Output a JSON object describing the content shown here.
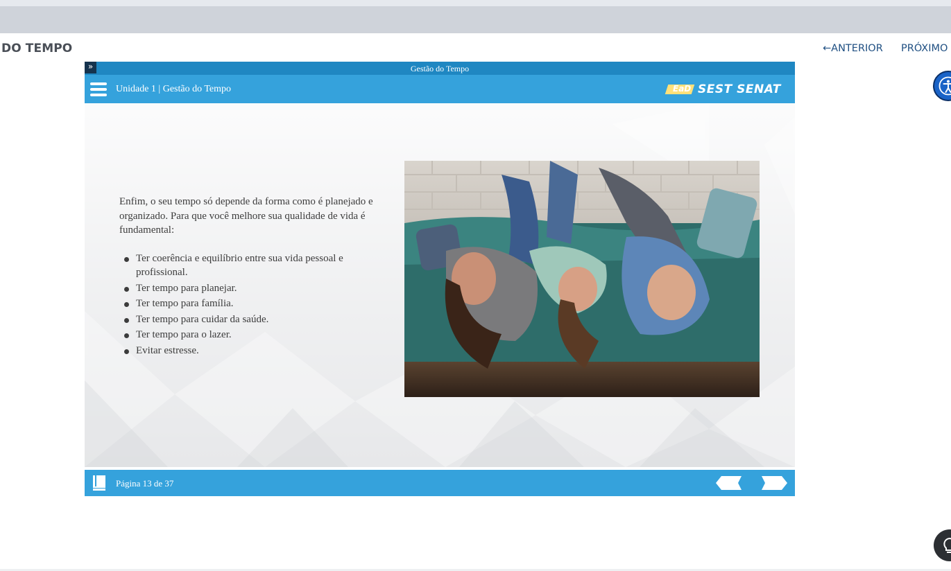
{
  "page": {
    "course_title": "DO TEMPO",
    "nav": {
      "previous_label": "ANTERIOR",
      "next_label": "PRÓXIMO"
    }
  },
  "player": {
    "title": "Gestão do Tempo",
    "unit_label": "Unidade 1 | Gestão do Tempo",
    "logo": {
      "ead": "EaD",
      "brand": "SEST SENAT"
    },
    "content": {
      "intro": "Enfim, o seu tempo só depende da forma como é planejado e organizado. Para que você melhore sua qualidade de vida é fundamental:",
      "bullets": [
        "Ter coerência e equilíbrio entre sua vida pessoal e profissional.",
        "Ter tempo para planejar.",
        "Ter tempo para família.",
        "Ter tempo para cuidar da saúde.",
        "Ter tempo para o lazer.",
        "Evitar estresse."
      ]
    },
    "footer": {
      "page_label": "Página 13 de 37"
    }
  },
  "colors": {
    "header_blue": "#35a2dc",
    "titlebar_blue": "#1f87c2",
    "nav_link": "#1f4f82",
    "accessibility_button": "#1a63c7",
    "help_button": "#2c2f33"
  },
  "icons": [
    "menu-icon",
    "expand-icon",
    "book-icon",
    "prev-arrow-icon",
    "next-arrow-icon",
    "accessibility-icon",
    "lightbulb-icon",
    "left-arrow-icon"
  ]
}
